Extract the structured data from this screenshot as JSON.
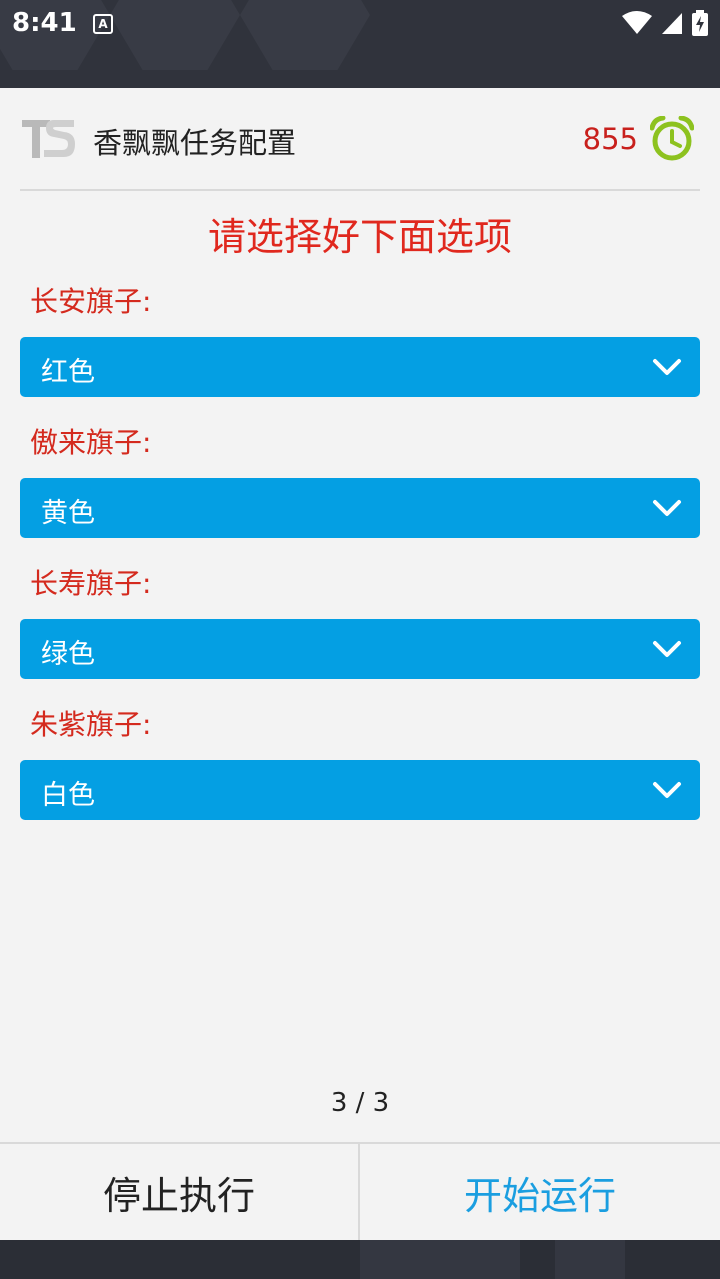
{
  "status_bar": {
    "time": "8:41",
    "notification_icon": "A"
  },
  "header": {
    "logo_icon": "ts-logo-icon",
    "title": "香飘飘任务配置",
    "counter": "855",
    "alarm_icon": "alarm-clock-icon",
    "alarm_color": "#8dc21f"
  },
  "form": {
    "headline": "请选择好下面选项",
    "fields": [
      {
        "label": "长安旗子:",
        "value": "红色"
      },
      {
        "label": "傲来旗子:",
        "value": "黄色"
      },
      {
        "label": "长寿旗子:",
        "value": "绿色"
      },
      {
        "label": "朱紫旗子:",
        "value": "白色"
      }
    ]
  },
  "pager": {
    "text": "3 / 3"
  },
  "actions": {
    "stop_label": "停止执行",
    "start_label": "开始运行"
  },
  "colors": {
    "accent": "#049fe3",
    "label_red": "#d42a1e",
    "counter_red": "#c8201c",
    "start_blue": "#1a9ee0"
  }
}
